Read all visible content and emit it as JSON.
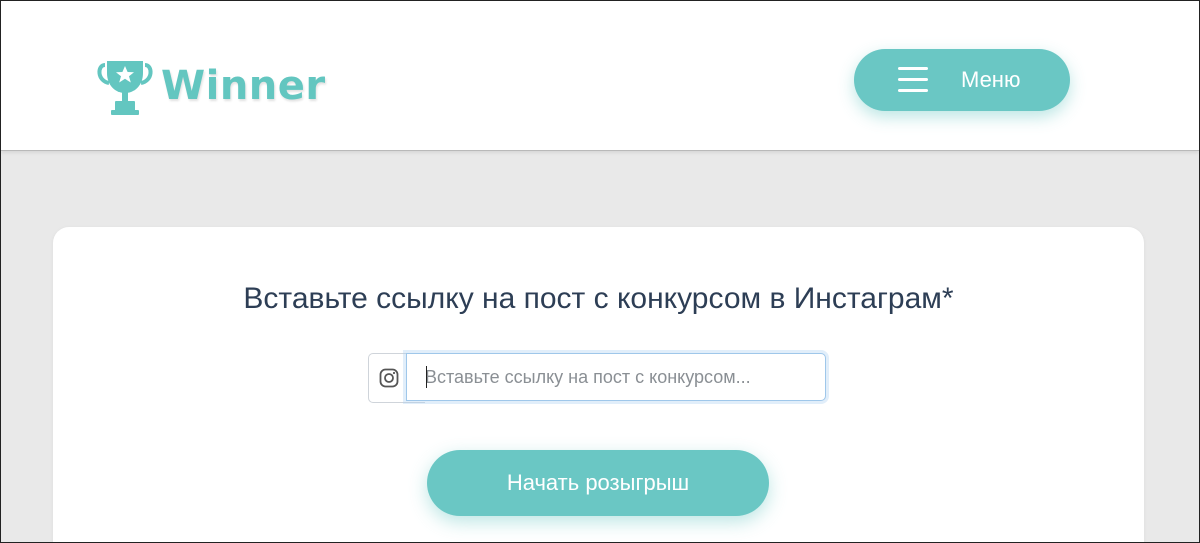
{
  "colors": {
    "brand": "#63c6c0",
    "button": "#6ac7c4",
    "title": "#2d3e55",
    "background": "#e9e9e9"
  },
  "header": {
    "logo_text": "Winner",
    "logo_icon": "trophy-icon",
    "menu_icon": "hamburger-icon",
    "menu_label": "Меню"
  },
  "main": {
    "title": "Вставьте ссылку на пост с конкурсом в Инстаграм*",
    "input_icon": "instagram-icon",
    "input_placeholder": "Вставьте ссылку на пост с конкурсом...",
    "input_value": "",
    "start_button_label": "Начать розыгрыш"
  }
}
